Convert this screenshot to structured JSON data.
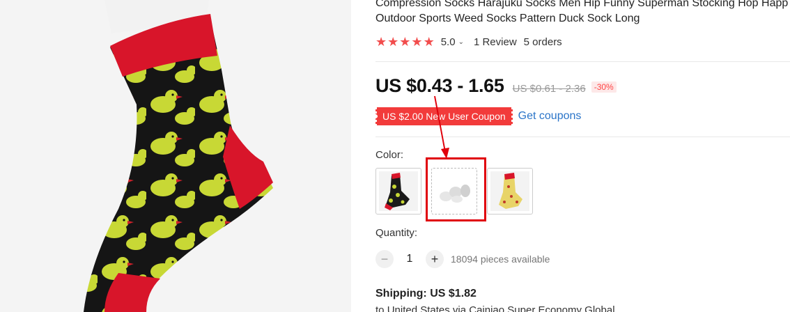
{
  "product": {
    "title_line1": "Compression Socks Harajuku Socks Men Hip Funny Superman Stocking Hop Happ",
    "title_line2": "Outdoor Sports Weed Socks Pattern Duck Sock Long"
  },
  "rating": {
    "stars": 5,
    "score": "5.0",
    "reviews": "1 Review",
    "orders": "5 orders"
  },
  "price": {
    "current": "US $0.43 - 1.65",
    "original": "US $0.61 - 2.36",
    "discount": "-30%"
  },
  "coupon": {
    "label": "US $2.00 New User Coupon",
    "link": "Get coupons"
  },
  "color": {
    "label": "Color:",
    "options": [
      "black duck",
      "white",
      "yellow"
    ],
    "selected": "white"
  },
  "quantity": {
    "label": "Quantity:",
    "minus": "−",
    "value": "1",
    "plus": "+",
    "available": "18094 pieces available"
  },
  "shipping": {
    "label": "Shipping:",
    "price": "US $1.82",
    "detail_prefix": "to",
    "destination": "United States via Cainiao Super Economy Global"
  },
  "colors": {
    "star": "#f24d4d",
    "coupon": "#f23b3b",
    "link": "#2a74c8",
    "highlight": "#e0000b"
  }
}
